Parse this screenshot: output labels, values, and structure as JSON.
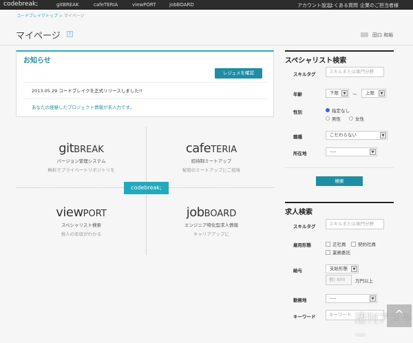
{
  "nav": {
    "logo": "codebreak;",
    "items": [
      "gitBREAK",
      "cafeTERIA",
      "viewPORT",
      "jobBOARD"
    ],
    "right": [
      "アカウント設定",
      "よくある質問",
      "企業のご担当者様"
    ]
  },
  "breadcrumb": {
    "home": "コードブレイクトップ",
    "sep": ">",
    "current": "マイページ"
  },
  "page": {
    "title": "マイページ",
    "help": "?",
    "user": "田口 和裕"
  },
  "notice": {
    "title": "お知らせ",
    "resume_button": "レジュメを確認",
    "news": "2013.05.29 コードブレイクを正式リリースしました!!",
    "warning": "あなたの経験したプロジェクト情報が未入力です。"
  },
  "services": {
    "center_logo": "codebreak;",
    "items": [
      {
        "a": "git",
        "b": "BREAK",
        "line1": "バージョン管理システム",
        "line2": "無料でプライベートリポジトリを"
      },
      {
        "a": "cafe",
        "b": "TERIA",
        "line1": "招待制ミートアップ",
        "line2": "秘密のミートアップにご招待"
      },
      {
        "a": "view",
        "b": "PORT",
        "line1": "スペシャリスト検索",
        "line2": "他人の年収がわかる"
      },
      {
        "a": "job",
        "b": "BOARD",
        "line1": "エンジニア特化型求人情報",
        "line2": "キャリアアップに"
      }
    ]
  },
  "specialist": {
    "title": "スペシャリスト検索",
    "skill_label": "スキルタグ",
    "skill_placeholder": "スキルまたは専門分野",
    "age_label": "年齢",
    "age_min": "下限",
    "tilde": "〜",
    "age_max": "上限",
    "gender_label": "性別",
    "gender_any": "指定なし",
    "male": "男性",
    "female": "女性",
    "gender_selected": "指定なし",
    "job_label": "職種",
    "job_value": "こだわらない",
    "loc_label": "所在地",
    "loc_value": "----",
    "search": "検索"
  },
  "jobs": {
    "title": "求人検索",
    "skill_label": "スキルタグ",
    "skill_placeholder": "スキルまたは専門分野",
    "emp_label": "雇用形態",
    "emp_options": [
      "正社員",
      "契約社員",
      "業務委託"
    ],
    "salary_label": "給与",
    "salary_type": "支給形態",
    "salary_placeholder": "例) 800",
    "salary_unit": "万円以上",
    "loc_label": "勤務地",
    "loc_value": "----",
    "kw_label": "キーワード",
    "kw_placeholder": "キーワード"
  },
  "watermark": "週刊アスキー",
  "to_top": "^",
  "colors": {
    "accent": "#1f8ea4",
    "topbar": "#2c2c2c"
  }
}
